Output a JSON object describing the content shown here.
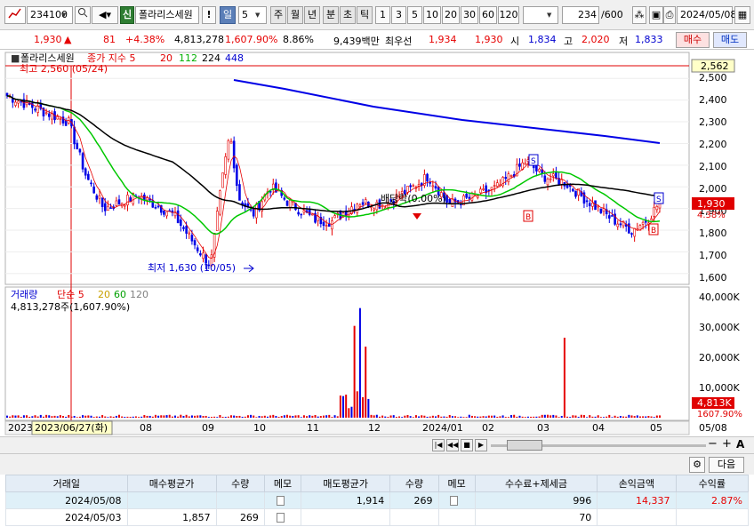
{
  "toolbar": {
    "code": "234100",
    "name_badge": "신",
    "name": "폴라리스세원",
    "warn": "!",
    "period_sel": "일",
    "period_num": "5",
    "periods": [
      "주",
      "월",
      "년",
      "분",
      "초",
      "틱"
    ],
    "nums": [
      "1",
      "3",
      "5",
      "10",
      "20",
      "30",
      "60",
      "120"
    ],
    "count": "234",
    "count_max": "/600",
    "date": "2024/05/08"
  },
  "quote": {
    "price": "1,930",
    "change": "81",
    "rate": "+4.38%",
    "volume": "4,813,278",
    "vol_rate": "1,607.90%",
    "turnover_rate": "8.86%",
    "amount": "9,439백만",
    "broker": "최우선",
    "ask": "1,934",
    "bid": "1,930",
    "open_label": "시",
    "open": "1,834",
    "high_label": "고",
    "high": "2,020",
    "low_label": "저",
    "low": "1,833",
    "buy": "매수",
    "sell": "매도"
  },
  "chart": {
    "legend_name": "폴라리스세원",
    "legend_ma": "종가 지수 5",
    "ma_periods": [
      "20",
      "112",
      "224",
      "448"
    ],
    "high_note": "최고 2,560 (05/24)",
    "low_note": "최저 1,630 (10/05)",
    "dividend": "배당락(0.00%)",
    "cur_price_tag": "2,562",
    "close_tag": "1,930",
    "close_rate": "4.38%",
    "price_axis": [
      "2,500",
      "2,400",
      "2,300",
      "2,200",
      "2,100",
      "2,000",
      "1,900",
      "1,800",
      "1,700",
      "1,600"
    ],
    "vol_legend": "거래량",
    "vol_ma": "단순 5",
    "vol_ma_periods": [
      "20",
      "60",
      "120"
    ],
    "vol_note": "4,813,278주(1,607.90%)",
    "vol_axis": [
      "40,000K",
      "30,000K",
      "20,000K",
      "10,000K"
    ],
    "vol_tag": "4,813K",
    "vol_rate_tag": "1607.90%",
    "date_axis": [
      "2023",
      "2023/06/27(화)",
      "08",
      "09",
      "10",
      "11",
      "12",
      "2024/01",
      "02",
      "03",
      "04",
      "05",
      "05/08"
    ],
    "colors": {
      "up": "#e60000",
      "down": "#0000e6",
      "ma5": "#e60000",
      "ma20": "#00c800",
      "ma112": "#000000",
      "ma224": "#0000e6"
    }
  },
  "chart_data": {
    "type": "candlestick",
    "y_range": [
      1550,
      2620
    ],
    "close_last": 1930,
    "high_marked": 2560,
    "low_marked": 1630
  },
  "grid_toolbar": {
    "next": "다음"
  },
  "grid": {
    "headers": [
      "거래일",
      "매수평균가",
      "수량",
      "메모",
      "매도평균가",
      "수량",
      "메모",
      "수수료+제세금",
      "손익금액",
      "수익률"
    ],
    "rows": [
      [
        "2024/05/08",
        "",
        "",
        "memo",
        "1,914",
        "269",
        "memo",
        "996",
        "14,337",
        "2.87%"
      ],
      [
        "2024/05/03",
        "1,857",
        "269",
        "memo",
        "",
        "",
        "",
        "70",
        "",
        ""
      ]
    ]
  }
}
